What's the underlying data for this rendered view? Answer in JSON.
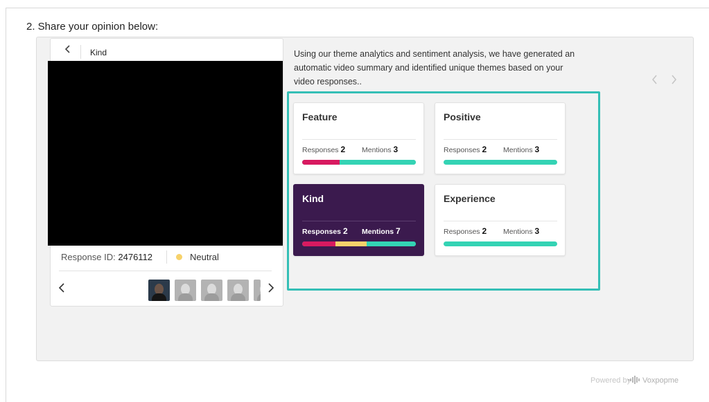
{
  "question": {
    "title": "2. Share your opinion below:"
  },
  "video": {
    "back_icon": "chevron-left-icon",
    "title": "Kind",
    "response_id_label": "Response ID:",
    "response_id": "2476112",
    "sentiment": {
      "label": "Neutral",
      "color": "#f7d26b"
    },
    "thumbnails_prev_icon": "chevron-left-icon",
    "thumbnails_next_icon": "chevron-right-icon",
    "thumbnails": [
      {
        "selected": true
      },
      {
        "selected": false
      },
      {
        "selected": false
      },
      {
        "selected": false
      },
      {
        "selected": false
      }
    ]
  },
  "summary": {
    "text": "Using our theme analytics and sentiment analysis, we have generated an automatic video summary and identified unique themes based on your video responses.."
  },
  "nav": {
    "prev_icon": "chevron-left-icon",
    "next_icon": "chevron-right-icon"
  },
  "colors": {
    "accent": "#35bfb6",
    "negative": "#d81a60",
    "neutral": "#f7d26b",
    "positive": "#34d3b4",
    "active_card": "#3b1a4e"
  },
  "themes": [
    {
      "name": "Feature",
      "active": false,
      "responses_label": "Responses",
      "responses": "2",
      "mentions_label": "Mentions",
      "mentions": "3",
      "sentiment": [
        {
          "value": 0.33,
          "color": "#d81a60"
        },
        {
          "value": 0.67,
          "color": "#34d3b4"
        }
      ]
    },
    {
      "name": "Positive",
      "active": false,
      "responses_label": "Responses",
      "responses": "2",
      "mentions_label": "Mentions",
      "mentions": "3",
      "sentiment": [
        {
          "value": 1.0,
          "color": "#34d3b4"
        }
      ]
    },
    {
      "name": "Kind",
      "active": true,
      "responses_label": "Responses",
      "responses": "2",
      "mentions_label": "Mentions",
      "mentions": "7",
      "sentiment": [
        {
          "value": 0.29,
          "color": "#d81a60"
        },
        {
          "value": 0.28,
          "color": "#f7d26b"
        },
        {
          "value": 0.43,
          "color": "#34d3b4"
        }
      ]
    },
    {
      "name": "Experience",
      "active": false,
      "responses_label": "Responses",
      "responses": "2",
      "mentions_label": "Mentions",
      "mentions": "3",
      "sentiment": [
        {
          "value": 1.0,
          "color": "#34d3b4"
        }
      ]
    }
  ],
  "footer": {
    "powered_by": "Powered by",
    "brand": "Voxpopme",
    "brand_icon": "voxpopme-logo-icon"
  }
}
